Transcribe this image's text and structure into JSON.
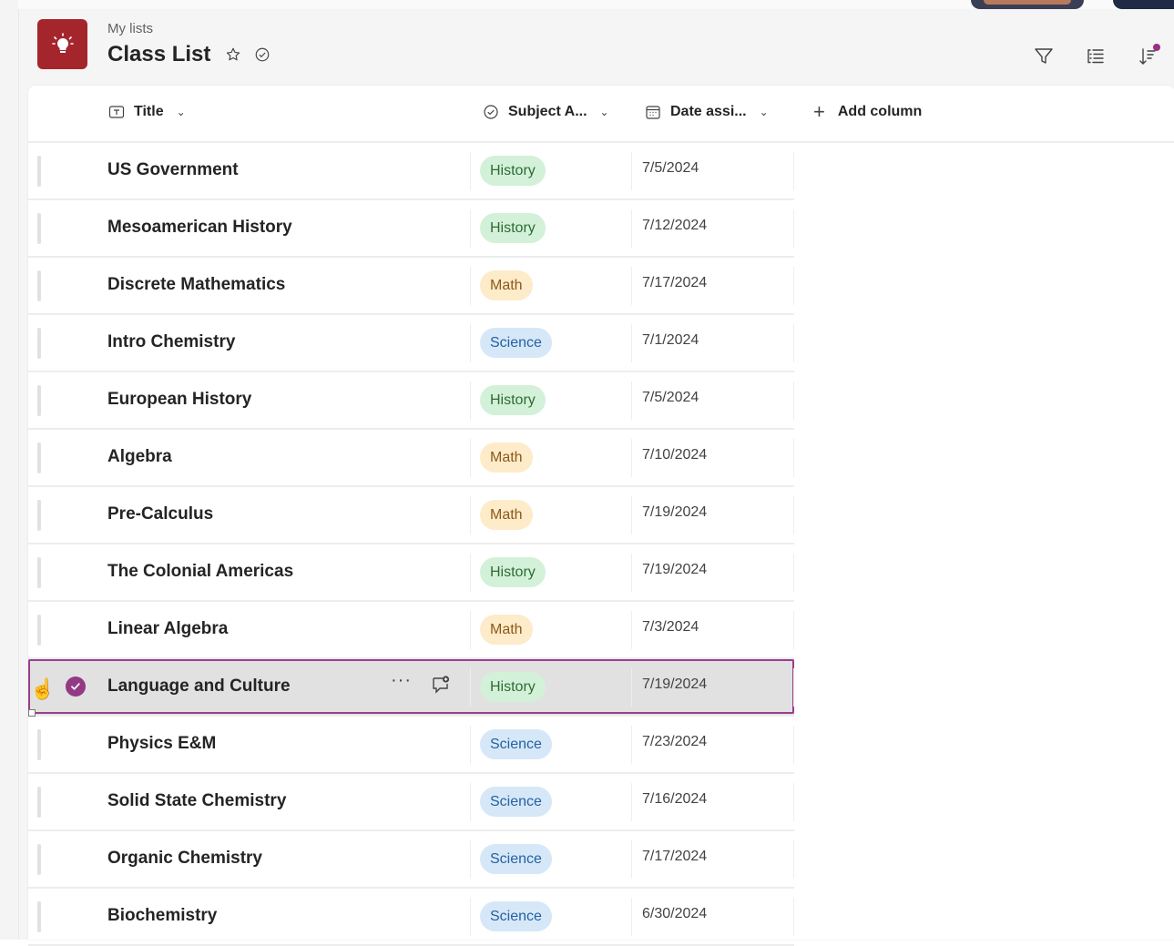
{
  "header": {
    "breadcrumb": "My lists",
    "title": "Class List"
  },
  "icons": {
    "app": "lightbulb-icon",
    "favorite": "star-icon",
    "status": "check-circle-icon",
    "filter": "filter-icon",
    "group": "group-list-icon",
    "sort": "sort-icon"
  },
  "colors": {
    "app_icon": "#a4262c",
    "accent": "#9c2e87",
    "history_pill": "#d3f1d8",
    "math_pill": "#fdebc9",
    "science_pill": "#d6e8f8"
  },
  "columns": {
    "title": "Title",
    "subject": "Subject A...",
    "date": "Date assi...",
    "add": "Add column"
  },
  "rows": [
    {
      "title": "US Government",
      "subject": "History",
      "date": "7/5/2024"
    },
    {
      "title": "Mesoamerican History",
      "subject": "History",
      "date": "7/12/2024"
    },
    {
      "title": "Discrete Mathematics",
      "subject": "Math",
      "date": "7/17/2024"
    },
    {
      "title": "Intro Chemistry",
      "subject": "Science",
      "date": "7/1/2024"
    },
    {
      "title": "European History",
      "subject": "History",
      "date": "7/5/2024"
    },
    {
      "title": "Algebra",
      "subject": "Math",
      "date": "7/10/2024"
    },
    {
      "title": "Pre-Calculus",
      "subject": "Math",
      "date": "7/19/2024"
    },
    {
      "title": "The Colonial Americas",
      "subject": "History",
      "date": "7/19/2024"
    },
    {
      "title": "Linear Algebra",
      "subject": "Math",
      "date": "7/3/2024"
    },
    {
      "title": "Language and Culture",
      "subject": "History",
      "date": "7/19/2024",
      "selected": true
    },
    {
      "title": "Physics E&M",
      "subject": "Science",
      "date": "7/23/2024"
    },
    {
      "title": "Solid State Chemistry",
      "subject": "Science",
      "date": "7/16/2024"
    },
    {
      "title": "Organic Chemistry",
      "subject": "Science",
      "date": "7/17/2024"
    },
    {
      "title": "Biochemistry",
      "subject": "Science",
      "date": "6/30/2024"
    }
  ]
}
